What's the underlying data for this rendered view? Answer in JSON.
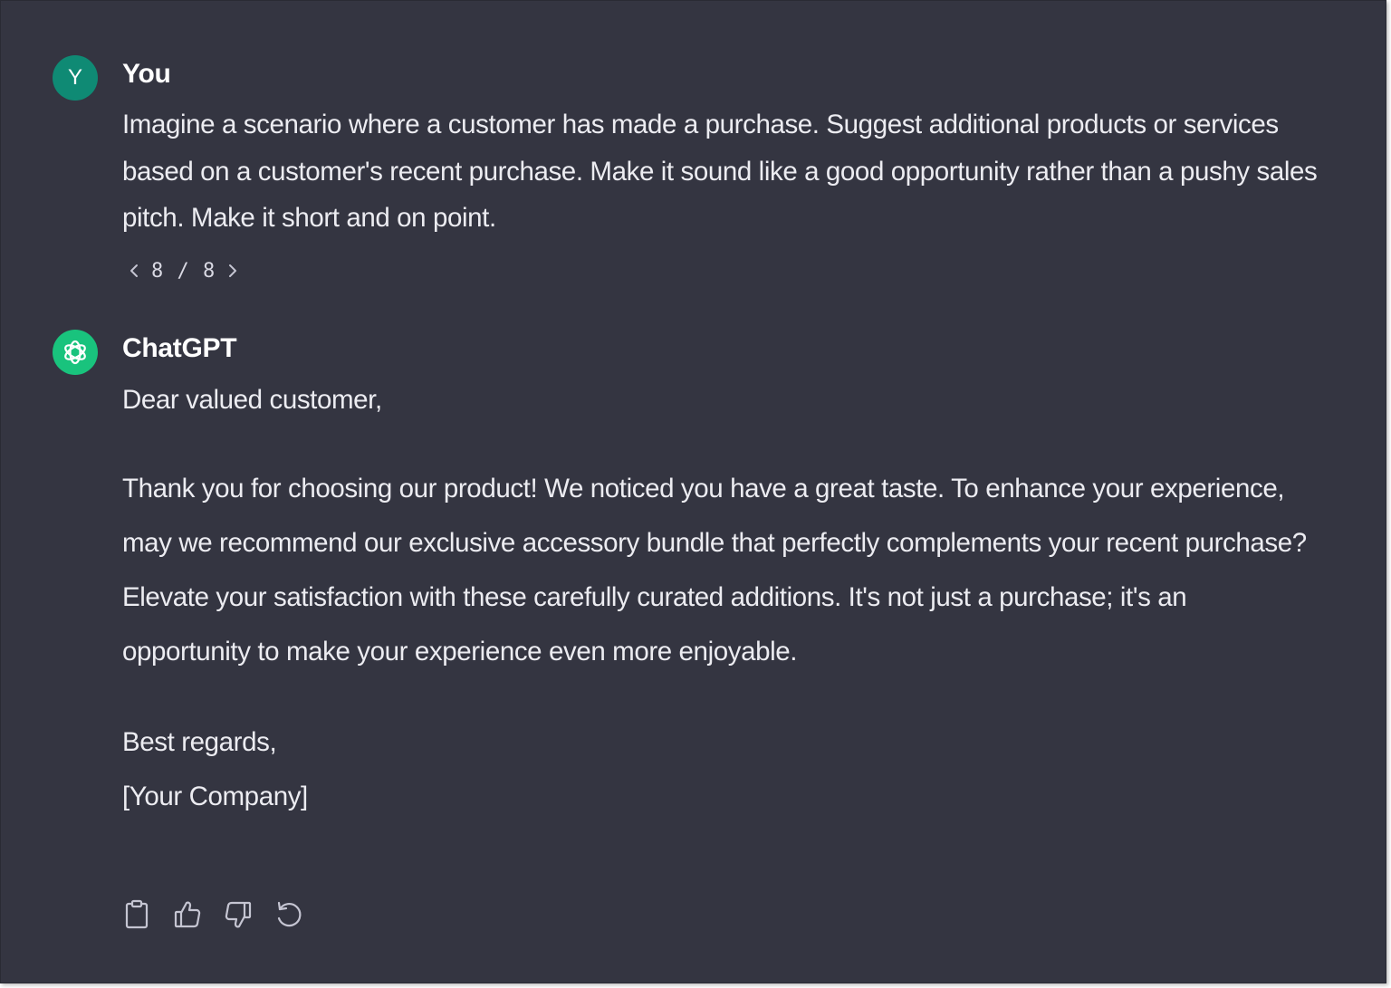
{
  "conversation": {
    "user": {
      "avatar_letter": "Y",
      "name": "You",
      "message": "Imagine a scenario where a customer has made a purchase. Suggest additional products or services based on a customer's recent purchase. Make it sound like a good opportunity rather than a pushy sales pitch. Make it short and on point.",
      "pager": {
        "count": "8 / 8",
        "prev_icon": "chevron-left-icon",
        "next_icon": "chevron-right-icon"
      }
    },
    "assistant": {
      "avatar_icon": "openai-logo-icon",
      "name": "ChatGPT",
      "greeting": "Dear valued customer,",
      "body": "Thank you for choosing our product! We noticed you have a great taste. To enhance your experience, may we recommend our exclusive accessory bundle that perfectly complements your recent purchase? Elevate your satisfaction with these carefully curated additions. It's not just a purchase; it's an opportunity to make your experience even more enjoyable.",
      "signoff": "Best regards,",
      "signature": "[Your Company]",
      "actions": [
        "copy-icon",
        "thumbs-up-icon",
        "thumbs-down-icon",
        "regenerate-icon"
      ]
    }
  },
  "colors": {
    "background": "#343541",
    "text": "#ececf1",
    "user_avatar": "#0f8a74",
    "assistant_avatar": "#19c37d",
    "icon": "#c5c5d2"
  }
}
